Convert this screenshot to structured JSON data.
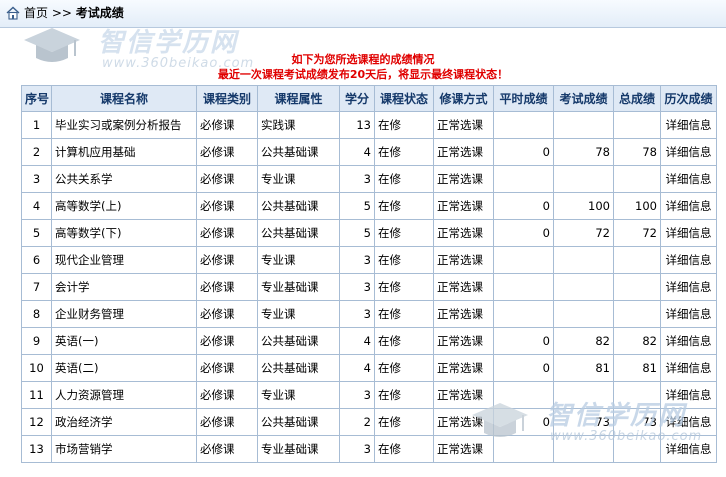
{
  "breadcrumb": {
    "home": "首页",
    "sep": ">>",
    "current": "考试成绩"
  },
  "watermark": {
    "title": "智信学历网",
    "url": "www.360beikao.com"
  },
  "notice": {
    "line1": "如下为您所选课程的成绩情况",
    "line2": "最近一次课程考试成绩发布20天后，将显示最终课程状态！"
  },
  "table": {
    "headers": [
      "序号",
      "课程名称",
      "课程类别",
      "课程属性",
      "学分",
      "课程状态",
      "修课方式",
      "平时成绩",
      "考试成绩",
      "总成绩",
      "历次成绩"
    ],
    "rows": [
      [
        "1",
        "毕业实习或案例分析报告",
        "必修课",
        "实践课",
        "13",
        "在修",
        "正常选课",
        "",
        "",
        "",
        "详细信息"
      ],
      [
        "2",
        "计算机应用基础",
        "必修课",
        "公共基础课",
        "4",
        "在修",
        "正常选课",
        "0",
        "78",
        "78",
        "详细信息"
      ],
      [
        "3",
        "公共关系学",
        "必修课",
        "专业课",
        "3",
        "在修",
        "正常选课",
        "",
        "",
        "",
        "详细信息"
      ],
      [
        "4",
        "高等数学(上)",
        "必修课",
        "公共基础课",
        "5",
        "在修",
        "正常选课",
        "0",
        "100",
        "100",
        "详细信息"
      ],
      [
        "5",
        "高等数学(下)",
        "必修课",
        "公共基础课",
        "5",
        "在修",
        "正常选课",
        "0",
        "72",
        "72",
        "详细信息"
      ],
      [
        "6",
        "现代企业管理",
        "必修课",
        "专业课",
        "3",
        "在修",
        "正常选课",
        "",
        "",
        "",
        "详细信息"
      ],
      [
        "7",
        "会计学",
        "必修课",
        "专业基础课",
        "3",
        "在修",
        "正常选课",
        "",
        "",
        "",
        "详细信息"
      ],
      [
        "8",
        "企业财务管理",
        "必修课",
        "专业课",
        "3",
        "在修",
        "正常选课",
        "",
        "",
        "",
        "详细信息"
      ],
      [
        "9",
        "英语(一)",
        "必修课",
        "公共基础课",
        "4",
        "在修",
        "正常选课",
        "0",
        "82",
        "82",
        "详细信息"
      ],
      [
        "10",
        "英语(二)",
        "必修课",
        "公共基础课",
        "4",
        "在修",
        "正常选课",
        "0",
        "81",
        "81",
        "详细信息"
      ],
      [
        "11",
        "人力资源管理",
        "必修课",
        "专业课",
        "3",
        "在修",
        "正常选课",
        "",
        "",
        "",
        "详细信息"
      ],
      [
        "12",
        "政治经济学",
        "必修课",
        "公共基础课",
        "2",
        "在修",
        "正常选课",
        "0",
        "73",
        "73",
        "详细信息"
      ],
      [
        "13",
        "市场营销学",
        "必修课",
        "专业基础课",
        "3",
        "在修",
        "正常选课",
        "",
        "",
        "",
        "详细信息"
      ]
    ]
  },
  "colors": {
    "header_bg": "#dfe9f5",
    "header_text": "#15396a",
    "border": "#a7bcd4",
    "notice": "#e00000"
  },
  "icons": {
    "home": "home-icon",
    "watermark": "graduation-cap-icon"
  }
}
